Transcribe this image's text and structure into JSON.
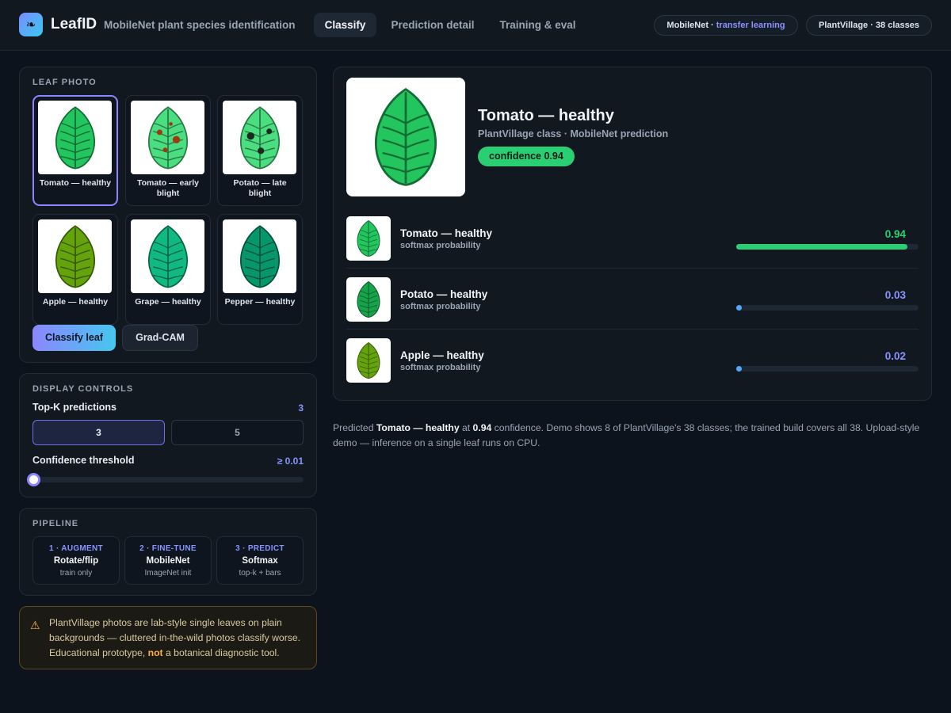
{
  "app": {
    "logo_glyph": "❧",
    "name": "LeafID",
    "subtitle": "MobileNet plant species identification"
  },
  "tabs": [
    {
      "label": "Classify",
      "active": true
    },
    {
      "label": "Prediction detail",
      "active": false
    },
    {
      "label": "Training & eval",
      "active": false
    }
  ],
  "pills": {
    "model": {
      "main": "MobileNet · ",
      "accent": "transfer learning"
    },
    "dataset": "PlantVillage · 38 classes"
  },
  "leaf_photo": {
    "title": "LEAF PHOTO",
    "thumbs": [
      {
        "label": "Tomato — healthy",
        "color": "#22c55e",
        "spots": "none",
        "selected": true
      },
      {
        "label": "Tomato — early blight",
        "color": "#4ade80",
        "spots": "early-blight",
        "selected": false
      },
      {
        "label": "Potato — late blight",
        "color": "#4ade80",
        "spots": "late-blight",
        "selected": false
      },
      {
        "label": "Apple — healthy",
        "color": "#65a30d",
        "spots": "none",
        "selected": false
      },
      {
        "label": "Grape — healthy",
        "color": "#10b981",
        "spots": "none",
        "selected": false
      },
      {
        "label": "Pepper — healthy",
        "color": "#059669",
        "spots": "none",
        "selected": false
      }
    ],
    "classify_button": "Classify leaf",
    "gradcam_button": "Grad-CAM"
  },
  "display_controls": {
    "title": "DISPLAY CONTROLS",
    "topk_label": "Top-K predictions",
    "topk_value": "3",
    "topk_options": [
      {
        "label": "3",
        "active": true
      },
      {
        "label": "5",
        "active": false
      }
    ],
    "threshold_label": "Confidence threshold",
    "threshold_value": "≥ 0.01",
    "threshold_fraction": 0.0
  },
  "pipeline": {
    "title": "PIPELINE",
    "steps": [
      {
        "kicker": "1 · AUGMENT",
        "title": "Rotate/flip",
        "sub": "train only"
      },
      {
        "kicker": "2 · FINE-TUNE",
        "title": "MobileNet",
        "sub": "ImageNet init"
      },
      {
        "kicker": "3 · PREDICT",
        "title": "Softmax",
        "sub": "top-k + bars"
      }
    ]
  },
  "warning": {
    "icon": "⚠",
    "text_a": "PlantVillage photos are lab-style single leaves on plain backgrounds — cluttered in-the-wild photos classify worse. Educational prototype, ",
    "text_bold": "not",
    "text_b": " a botanical diagnostic tool."
  },
  "prediction": {
    "title": "Tomato — healthy",
    "subtitle": "PlantVillage class · MobileNet prediction",
    "confidence_badge": "confidence 0.94",
    "hero_color": "#22c55e"
  },
  "topk": [
    {
      "name": "Tomato — healthy",
      "sub": "softmax probability",
      "value_text": "0.94",
      "value": 0.94,
      "color": "#2bcf73",
      "leaf_color": "#22c55e"
    },
    {
      "name": "Potato — healthy",
      "sub": "softmax probability",
      "value_text": "0.03",
      "value": 0.03,
      "color": "#8a93ff",
      "leaf_color": "#16a34a"
    },
    {
      "name": "Apple — healthy",
      "sub": "softmax probability",
      "value_text": "0.02",
      "value": 0.02,
      "color": "#8a93ff",
      "leaf_color": "#65a30d"
    }
  ],
  "footnote": {
    "a": "Predicted ",
    "b": "Tomato — healthy",
    "c": " at ",
    "d": "0.94",
    "e": " confidence. Demo shows 8 of PlantVillage's 38 classes; the trained build covers all 38. Upload-style demo — inference on a single leaf runs on CPU."
  },
  "colors": {
    "accent": "#8a93ff",
    "success": "#2bcf73",
    "bar_dot": "#4fa8ff"
  }
}
